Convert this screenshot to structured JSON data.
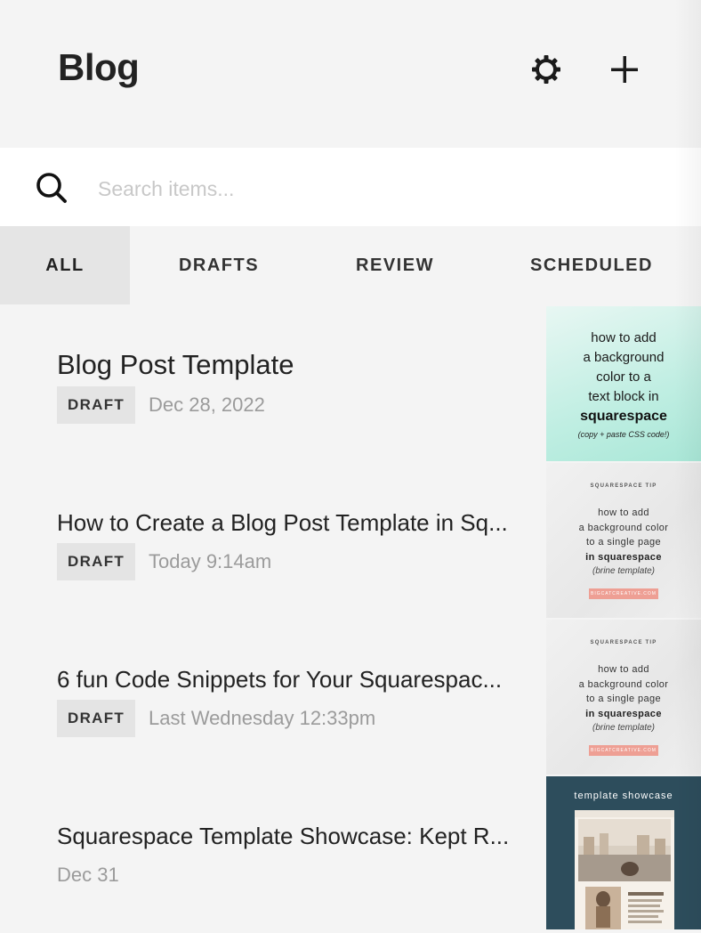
{
  "header": {
    "title": "Blog",
    "settings_icon": "gear-icon",
    "add_icon": "plus-icon"
  },
  "search": {
    "icon": "search-icon",
    "placeholder": "Search items...",
    "value": ""
  },
  "tabs": [
    {
      "label": "ALL",
      "active": true
    },
    {
      "label": "DRAFTS",
      "active": false
    },
    {
      "label": "REVIEW",
      "active": false
    },
    {
      "label": "SCHEDULED",
      "active": false
    }
  ],
  "posts": [
    {
      "title": "Blog Post Template",
      "status": "DRAFT",
      "date": "Dec 28, 2022",
      "thumbnail": {
        "lines": [
          "how to add",
          "a background",
          "color to a",
          "text block in"
        ],
        "bold": "squarespace",
        "small": "(copy + paste CSS code!)"
      }
    },
    {
      "title": "How to Create a Blog Post Template in Sq...",
      "status": "DRAFT",
      "date": "Today 9:14am",
      "thumbnail": {
        "tip": "SQUARESPACE TIP",
        "lines": [
          "how to add",
          "a background color",
          "to a single page"
        ],
        "bold": "in squarespace",
        "italic": "(brine template)",
        "button": "BIGCATCREATIVE.COM"
      }
    },
    {
      "title": "6 fun Code Snippets for Your Squarespac...",
      "status": "DRAFT",
      "date": "Last Wednesday 12:33pm",
      "thumbnail": {
        "tip": "SQUARESPACE TIP",
        "lines": [
          "how to add",
          "a background color",
          "to a single page"
        ],
        "bold": "in squarespace",
        "italic": "(brine template)",
        "button": "BIGCATCREATIVE.COM"
      }
    },
    {
      "title": "Squarespace Template Showcase: Kept R...",
      "status": "",
      "date": "Dec 31",
      "thumbnail": {
        "header": "template showcase"
      }
    }
  ],
  "colors": {
    "background": "#f4f4f4",
    "active_tab": "#e5e5e5",
    "badge": "#e4e4e4",
    "date_text": "#9b9b9b",
    "thumb_teal": "#bfeee2",
    "thumb_navy": "#2d4d5c",
    "thumb_button": "#ee9f94"
  }
}
